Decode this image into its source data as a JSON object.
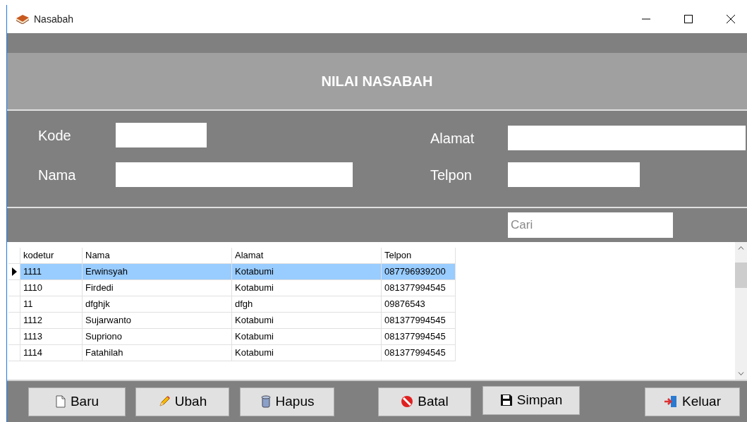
{
  "window": {
    "title": "Nasabah"
  },
  "header": {
    "title": "NILAI NASABAH"
  },
  "form": {
    "fields": [
      {
        "label": "Kode"
      },
      {
        "label": "Nama"
      },
      {
        "label": "Alamat"
      },
      {
        "label": "Telpon"
      }
    ]
  },
  "search": {
    "placeholder": "Cari"
  },
  "table": {
    "columns": [
      "kodetur",
      "Nama",
      "Alamat",
      "Telpon"
    ],
    "rows": [
      {
        "cells": [
          "1111",
          "Erwinsyah",
          "Kotabumi",
          "087796939200"
        ],
        "selected": true
      },
      {
        "cells": [
          "1110",
          "Firdedi",
          "Kotabumi",
          "081377994545"
        ],
        "selected": false
      },
      {
        "cells": [
          "11",
          "dfghjk",
          "dfgh",
          "09876543"
        ],
        "selected": false
      },
      {
        "cells": [
          "1112",
          "Sujarwanto",
          "Kotabumi",
          "081377994545"
        ],
        "selected": false
      },
      {
        "cells": [
          "1113",
          "Supriono",
          "Kotabumi",
          "081377994545"
        ],
        "selected": false
      },
      {
        "cells": [
          "1114",
          "Fatahilah",
          "Kotabumi",
          "081377994545"
        ],
        "selected": false
      }
    ]
  },
  "buttons": [
    {
      "label": "Baru",
      "kind": "new"
    },
    {
      "label": "Ubah",
      "kind": "edit"
    },
    {
      "label": "Hapus",
      "kind": "delete"
    },
    {
      "label": "Batal",
      "kind": "cancel"
    },
    {
      "label": "Simpan",
      "kind": "save"
    },
    {
      "label": "Keluar",
      "kind": "exit"
    }
  ]
}
